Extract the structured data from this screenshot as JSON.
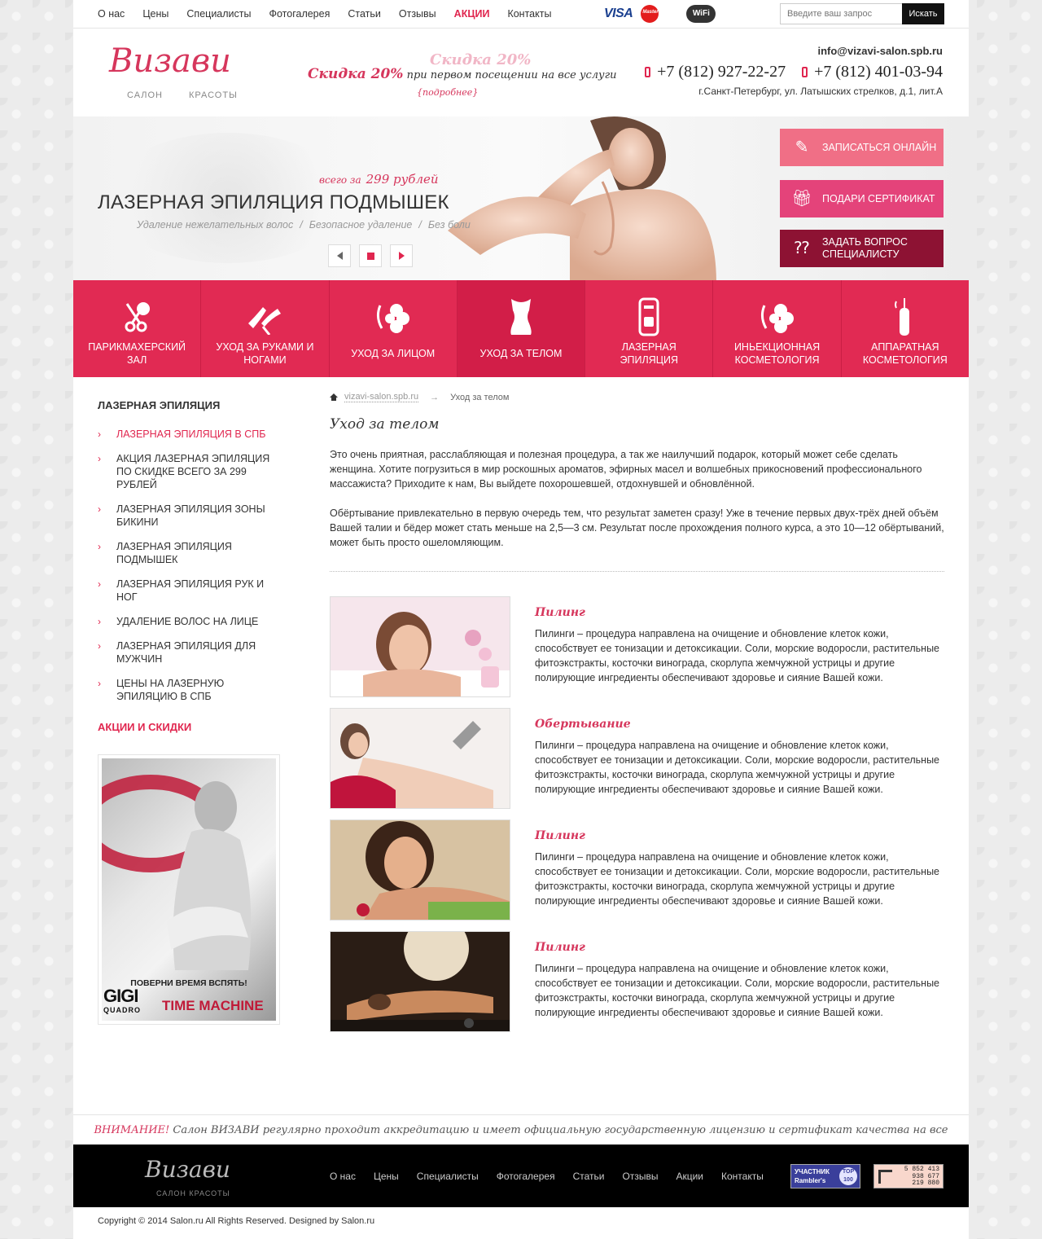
{
  "topnav": {
    "items": [
      "О нас",
      "Цены",
      "Специалисты",
      "Фотогалерея",
      "Статьи",
      "Отзывы",
      "АКЦИИ",
      "Контакты"
    ],
    "cards": {
      "visa": "VISA",
      "mastercard": "MasterCard",
      "wifi": "WiFi"
    },
    "search_placeholder": "Введите ваш запрос",
    "search_button": "Искать"
  },
  "header": {
    "logo_script": "Визави",
    "logo_sub_left": "САЛОН",
    "logo_sub_right": "КРАСОТЫ",
    "promo_big": "Скидка 20%",
    "promo_text": "при первом посещении на все услуги",
    "promo_more": "подробнее",
    "email": "info@vizavi-salon.spb.ru",
    "phone1": "+7 (812) 927-22-27",
    "phone2": "+7 (812) 401-03-94",
    "address": "г.Санкт-Петербург, ул. Латышских стрелков,  д.1, лит.А"
  },
  "banner": {
    "price_prefix": "всего за",
    "price": "299 рублей",
    "title": "ЛАЗЕРНАЯ ЭПИЛЯЦИЯ ПОДМЫШЕК",
    "tags": [
      "Удаление нежелательных волос",
      "/",
      "Безопасное удаление",
      "/",
      "Без боли"
    ],
    "buttons": [
      "ЗАПИСАТЬСЯ ОНЛАЙН",
      "ПОДАРИ СЕРТИФИКАТ",
      "ЗАДАТЬ ВОПРОС СПЕЦИАЛИСТУ"
    ]
  },
  "categories": [
    {
      "label": "ПАРИКМАХЕРСКИЙ ЗАЛ",
      "icon": "scissors-icon"
    },
    {
      "label": "УХОД ЗА РУКАМИ И НОГАМИ",
      "icon": "hands-icon"
    },
    {
      "label": "УХОД ЗА ЛИЦОМ",
      "icon": "face-flower-icon"
    },
    {
      "label": "УХОД ЗА ТЕЛОМ",
      "icon": "corset-icon"
    },
    {
      "label": "ЛАЗЕРНАЯ ЭПИЛЯЦИЯ",
      "icon": "laser-device-icon"
    },
    {
      "label": "ИНЬЕКЦИОННАЯ КОСМЕТОЛОГИЯ",
      "icon": "injection-icon"
    },
    {
      "label": "АППАРАТНАЯ КОСМЕТОЛОГИЯ",
      "icon": "apparatus-icon"
    }
  ],
  "sidebar": {
    "title": "ЛАЗЕРНАЯ ЭПИЛЯЦИЯ",
    "items": [
      "ЛАЗЕРНАЯ ЭПИЛЯЦИЯ В СПБ",
      "АКЦИЯ ЛАЗЕРНАЯ ЭПИЛЯЦИЯ ПО СКИДКЕ ВСЕГО ЗА 299 РУБЛЕЙ",
      "ЛАЗЕРНАЯ ЭПИЛЯЦИЯ ЗОНЫ БИКИНИ",
      "ЛАЗЕРНАЯ ЭПИЛЯЦИЯ ПОДМЫШЕК",
      "ЛАЗЕРНАЯ ЭПИЛЯЦИЯ РУК И НОГ",
      "УДАЛЕНИЕ ВОЛОС НА ЛИЦЕ",
      "ЛАЗЕРНАЯ ЭПИЛЯЦИЯ ДЛЯ МУЖЧИН",
      "ЦЕНЫ НА ЛАЗЕРНУЮ ЭПИЛЯЦИЮ В СПБ"
    ],
    "promo_title": "АКЦИИ И СКИДКИ",
    "ad_caption": "ПОВЕРНИ ВРЕМЯ ВСПЯТЬ!",
    "ad_brand": "GIGI",
    "ad_brand_sub": "QUADRO",
    "ad_product": "TIME MACHINE"
  },
  "content": {
    "breadcrumb_home": "vizavi-salon.spb.ru",
    "breadcrumb_current": "Уход за телом",
    "title": "Уход за телом",
    "paragraphs": [
      "Это очень приятная, расслабляющая и полезная процедура, а так же наилучший подарок, который может себе сделать женщина. Хотите погрузиться в мир роскошных ароматов, эфирных масел и волшебных прикосновений профессионального массажиста? Приходите к нам, Вы выйдете похорошевшей, отдохнувшей и обновлённой.",
      "Обёртывание привлекательно в первую очередь тем, что результат заметен сразу! Уже в течение первых двух-трёх дней объём Вашей талии и бёдер может стать меньше на 2,5—3 см. Результат после прохождения полного курса, а это 10—12 обёртываний, может быть просто ошеломляющим."
    ],
    "services": [
      {
        "title": "Пилинг",
        "text": "Пилинги – процедура направлена на очищение и обновление клеток кожи, способствует ее тонизации и детоксикации. Соли, морские водоросли, растительные фитоэкстракты, косточки винограда, скорлупа жемчужной устрицы и другие полирующие ингредиенты обеспечивают здоровье и сияние Вашей кожи."
      },
      {
        "title": "Обертывание",
        "text": "Пилинги – процедура направлена на очищение и обновление клеток кожи, способствует ее тонизации и детоксикации. Соли, морские водоросли, растительные фитоэкстракты, косточки винограда, скорлупа жемчужной устрицы и другие полирующие ингредиенты обеспечивают здоровье и сияние Вашей кожи."
      },
      {
        "title": "Пилинг",
        "text": "Пилинги – процедура направлена на очищение и обновление клеток кожи, способствует ее тонизации и детоксикации. Соли, морские водоросли, растительные фитоэкстракты, косточки винограда, скорлупа жемчужной устрицы и другие полирующие ингредиенты обеспечивают здоровье и сияние Вашей кожи."
      },
      {
        "title": "Пилинг",
        "text": "Пилинги – процедура направлена на очищение и обновление клеток кожи, способствует ее тонизации и детоксикации. Соли, морские водоросли, растительные фитоэкстракты, косточки винограда, скорлупа жемчужной устрицы и другие полирующие ингредиенты обеспечивают здоровье и сияние Вашей кожи."
      }
    ]
  },
  "notice": {
    "label": "ВНИМАНИЕ!",
    "text": "Салон ВИЗАВИ регулярно проходит аккредитацию и имеет официальную государственную лицензию и сертификат качества на все оказываемые виды услуг!"
  },
  "footer": {
    "logo_script": "Визави",
    "logo_sub": "САЛОН   КРАСОТЫ",
    "nav": [
      "О нас",
      "Цены",
      "Специалисты",
      "Фотогалерея",
      "Статьи",
      "Отзывы",
      "Акции",
      "Контакты"
    ],
    "rambler_line1": "УЧАСТНИК",
    "rambler_line2": "Rambler's",
    "rambler_top": "TOP 100",
    "counter_lines": [
      "5 852 413",
      "938 677",
      "219 880"
    ],
    "copyright": "Copyright © 2014 Salon.ru All Rights Reserved. Designed by Salon.ru"
  },
  "colors": {
    "accent": "#e12a53",
    "accent_dark": "#8d1233",
    "pink": "#f06f86",
    "magenta": "#e4437a"
  }
}
